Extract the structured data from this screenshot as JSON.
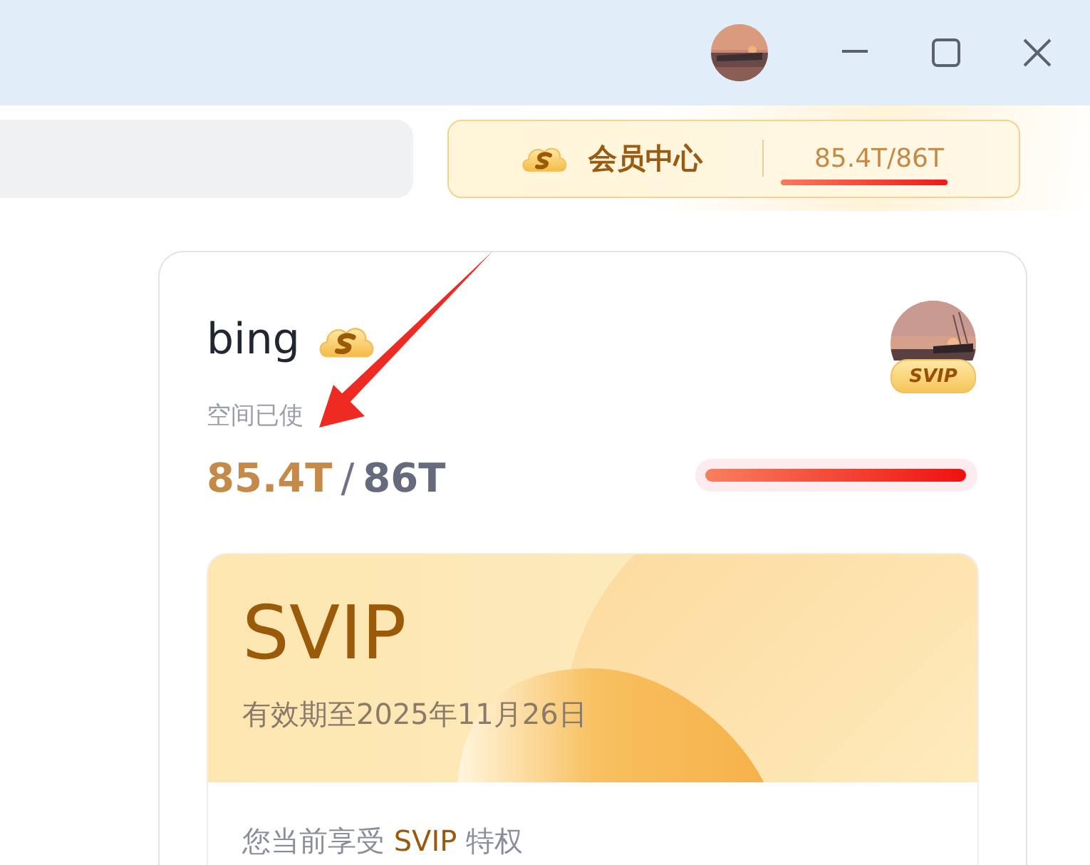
{
  "member_center": {
    "label": "会员中心",
    "storage": "85.4T/86T",
    "level": 0.993
  },
  "account": {
    "username": "bing",
    "badge": "SVIP",
    "storage_label": "空间已使",
    "used": "85.4T",
    "separator": "/",
    "total": "86T",
    "level": 0.993
  },
  "membership": {
    "tier": "SVIP",
    "expiry": "有效期至2025年11月26日",
    "privilege_text": "您当前享受 **SVIP** 特权"
  }
}
